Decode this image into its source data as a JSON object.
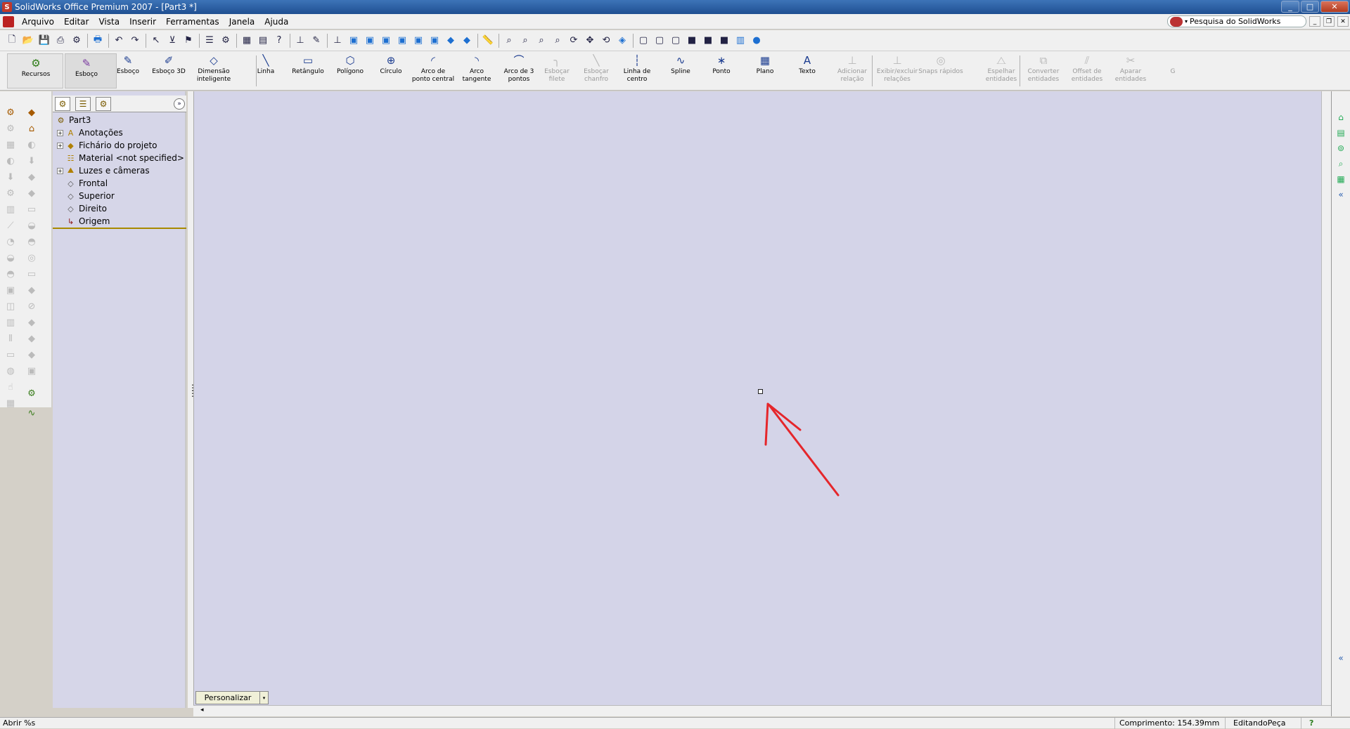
{
  "window": {
    "title": "SolidWorks Office Premium 2007 - [Part3 *]",
    "logo_text": "S",
    "controls": {
      "minimize": "_",
      "maximize": "□",
      "close": "✕"
    }
  },
  "menubar": {
    "items": [
      "Arquivo",
      "Editar",
      "Vista",
      "Inserir",
      "Ferramentas",
      "Janela",
      "Ajuda"
    ],
    "search": {
      "label": "Pesquisa do SolidWorks",
      "caret": "▾"
    },
    "mdi": {
      "minimize": "_",
      "restore": "❐",
      "close": "✕"
    }
  },
  "standard_toolbar": {
    "icons": [
      "new-icon",
      "open-icon",
      "save-icon",
      "print-icon",
      "options-icon",
      "sep",
      "print-preview-icon",
      "sep",
      "undo-icon",
      "redo-icon",
      "sep",
      "select-icon",
      "select-filter-icon",
      "rebuild-icon",
      "sep",
      "file-properties-icon",
      "options2-icon",
      "sep",
      "window-tile-icon",
      "layer-icon",
      "help-icon",
      "sep",
      "sketch-relations-icon",
      "sketch-tools-icon",
      "sep",
      "normal-to-icon",
      "front-view-icon",
      "back-view-icon",
      "left-view-icon",
      "right-view-icon",
      "top-view-icon",
      "bottom-view-icon",
      "isometric-icon",
      "dimetric-icon",
      "sep",
      "measure-icon",
      "sep",
      "zoom-fit-icon",
      "zoom-area-icon",
      "zoom-inout-icon",
      "zoom-selection-icon",
      "rotate-icon",
      "pan-icon",
      "roll-icon",
      "view-orientation-icon",
      "sep",
      "wireframe-icon",
      "hidden-lines-visible-icon",
      "hidden-lines-removed-icon",
      "shaded-edges-icon",
      "shaded-icon",
      "shadows-icon",
      "section-view-icon",
      "realview-icon"
    ],
    "glyphs": {
      "new-icon": "🗋",
      "open-icon": "📂",
      "save-icon": "💾",
      "print-icon": "⎙",
      "options-icon": "⚙",
      "print-preview-icon": "🖶",
      "undo-icon": "↶",
      "redo-icon": "↷",
      "select-icon": "↖",
      "select-filter-icon": "⊻",
      "rebuild-icon": "⚑",
      "file-properties-icon": "☰",
      "options2-icon": "⚙",
      "window-tile-icon": "▦",
      "layer-icon": "▤",
      "help-icon": "?",
      "sketch-relations-icon": "⊥",
      "sketch-tools-icon": "✎",
      "normal-to-icon": "⊥",
      "front-view-icon": "▣",
      "back-view-icon": "▣",
      "left-view-icon": "▣",
      "right-view-icon": "▣",
      "top-view-icon": "▣",
      "bottom-view-icon": "▣",
      "isometric-icon": "◆",
      "dimetric-icon": "◆",
      "measure-icon": "📏",
      "zoom-fit-icon": "⌕",
      "zoom-area-icon": "⌕",
      "zoom-inout-icon": "⌕",
      "zoom-selection-icon": "⌕",
      "rotate-icon": "⟳",
      "pan-icon": "✥",
      "roll-icon": "⟲",
      "view-orientation-icon": "◈",
      "wireframe-icon": "▢",
      "hidden-lines-visible-icon": "▢",
      "hidden-lines-removed-icon": "▢",
      "shaded-edges-icon": "■",
      "shaded-icon": "■",
      "shadows-icon": "■",
      "section-view-icon": "▥",
      "realview-icon": "●"
    }
  },
  "command_manager": {
    "tabs": [
      {
        "name": "recursos",
        "label": "Recursos",
        "icon": "features-icon",
        "glyph": "⚙"
      },
      {
        "name": "esboco-tab",
        "label": "Esboço",
        "icon": "sketch-tab-icon",
        "glyph": "✎"
      }
    ],
    "tools": [
      {
        "name": "esboco",
        "label": "Esboço",
        "icon": "sketch-icon",
        "glyph": "✎",
        "enabled": true
      },
      {
        "name": "esboco-3d",
        "label": "Esboço 3D",
        "icon": "sketch-3d-icon",
        "glyph": "✐",
        "enabled": true
      },
      {
        "name": "dimensao-inteligente",
        "label": "Dimensão inteligente",
        "icon": "smart-dimension-icon",
        "glyph": "◇",
        "enabled": true
      },
      {
        "name": "linha",
        "label": "Linha",
        "icon": "line-icon",
        "glyph": "╲",
        "enabled": true
      },
      {
        "name": "retangulo",
        "label": "Retângulo",
        "icon": "rectangle-icon",
        "glyph": "▭",
        "enabled": true
      },
      {
        "name": "poligono",
        "label": "Polígono",
        "icon": "polygon-icon",
        "glyph": "⬡",
        "enabled": true
      },
      {
        "name": "circulo",
        "label": "Círculo",
        "icon": "circle-icon",
        "glyph": "⊕",
        "enabled": true
      },
      {
        "name": "arco-ponto-central",
        "label": "Arco de ponto central",
        "icon": "centerpoint-arc-icon",
        "glyph": "◜",
        "enabled": true
      },
      {
        "name": "arco-tangente",
        "label": "Arco tangente",
        "icon": "tangent-arc-icon",
        "glyph": "◝",
        "enabled": true
      },
      {
        "name": "arco-3-pontos",
        "label": "Arco de 3 pontos",
        "icon": "three-point-arc-icon",
        "glyph": "⌒",
        "enabled": true
      },
      {
        "name": "esbocar-filete",
        "label": "Esboçar filete",
        "icon": "sketch-fillet-icon",
        "glyph": "╮",
        "enabled": false
      },
      {
        "name": "esbocar-chanfro",
        "label": "Esboçar chanfro",
        "icon": "sketch-chamfer-icon",
        "glyph": "╲",
        "enabled": false
      },
      {
        "name": "linha-de-centro",
        "label": "Linha de centro",
        "icon": "centerline-icon",
        "glyph": "┆",
        "enabled": true
      },
      {
        "name": "spline",
        "label": "Spline",
        "icon": "spline-icon",
        "glyph": "∿",
        "enabled": true
      },
      {
        "name": "ponto",
        "label": "Ponto",
        "icon": "point-icon",
        "glyph": "∗",
        "enabled": true
      },
      {
        "name": "plano",
        "label": "Plano",
        "icon": "plane-icon",
        "glyph": "▦",
        "enabled": true
      },
      {
        "name": "texto",
        "label": "Texto",
        "icon": "text-icon",
        "glyph": "A",
        "enabled": true
      },
      {
        "name": "adicionar-relacao",
        "label": "Adicionar relação",
        "icon": "add-relation-icon",
        "glyph": "⊥",
        "enabled": false
      },
      {
        "name": "exibir-excluir-relacoes",
        "label": "Exibir/excluir relações",
        "icon": "display-delete-relations-icon",
        "glyph": "⊥",
        "enabled": false
      },
      {
        "name": "snaps-rapidos",
        "label": "Snaps rápidos",
        "icon": "quick-snaps-icon",
        "glyph": "◎",
        "enabled": false
      },
      {
        "name": "espelhar-entidades",
        "label": "Espelhar entidades",
        "icon": "mirror-entities-icon",
        "glyph": "⧍",
        "enabled": false
      },
      {
        "name": "converter-entidades",
        "label": "Converter entidades",
        "icon": "convert-entities-icon",
        "glyph": "⧉",
        "enabled": false
      },
      {
        "name": "offset-entidades",
        "label": "Offset de entidades",
        "icon": "offset-entities-icon",
        "glyph": "⫽",
        "enabled": false
      },
      {
        "name": "aparar-entidades",
        "label": "Aparar entidades",
        "icon": "trim-entities-icon",
        "glyph": "✂",
        "enabled": false
      },
      {
        "name": "cut-off",
        "label": "G",
        "icon": "truncated-tool-icon",
        "glyph": "",
        "enabled": false
      }
    ]
  },
  "feature_manager": {
    "tabs": [
      "feature-tree-tab-icon",
      "property-manager-tab-icon",
      "configuration-manager-tab-icon"
    ],
    "tab_glyphs": [
      "⚙",
      "☰",
      "⚙"
    ],
    "collapse_glyph": "»",
    "root": "Part3",
    "items": [
      {
        "label": "Anotações",
        "icon": "annotations-icon",
        "glyph": "A",
        "expandable": true
      },
      {
        "label": "Fichário do projeto",
        "icon": "design-binder-icon",
        "glyph": "◆",
        "expandable": true
      },
      {
        "label": "Material <not specified>",
        "icon": "material-icon",
        "glyph": "☷",
        "expandable": false
      },
      {
        "label": "Luzes e câmeras",
        "icon": "lights-cameras-icon",
        "glyph": "⛰",
        "expandable": true
      },
      {
        "label": "Frontal",
        "icon": "plane-icon",
        "glyph": "◇",
        "expandable": false
      },
      {
        "label": "Superior",
        "icon": "plane-icon",
        "glyph": "◇",
        "expandable": false
      },
      {
        "label": "Direito",
        "icon": "plane-icon",
        "glyph": "◇",
        "expandable": false
      },
      {
        "label": "Origem",
        "icon": "origin-icon",
        "glyph": "↳",
        "expandable": false
      }
    ],
    "expand_glyph": "+"
  },
  "graphics": {
    "background": "#d4d4e8",
    "annotation_color": "#e5262b",
    "customize": {
      "label": "Personalizar",
      "caret": "▾"
    }
  },
  "task_pane": {
    "icons": [
      "home-icon",
      "design-library-icon",
      "file-explorer-icon",
      "search-icon",
      "view-palette-icon",
      "collapse-icon"
    ],
    "glyphs": [
      "⌂",
      "▤",
      "⊚",
      "⌕",
      "▦",
      "«"
    ],
    "bottom_glyph": "«"
  },
  "statusbar": {
    "left": "Abrir %s",
    "length": "Comprimento: 154.39mm",
    "mode": "EditandoPeça",
    "help": "?"
  }
}
